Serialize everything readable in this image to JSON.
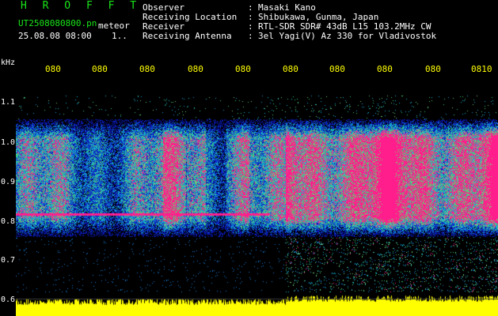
{
  "header": {
    "title": "H R O F F T",
    "filename": "UT2508080800.pn",
    "meteor_label": "meteor",
    "timestamp": "25.08.08 08:00",
    "index": "1..",
    "info": [
      {
        "label": "Observer",
        "value": "Masaki Kano"
      },
      {
        "label": "Receiving Location",
        "value": "Shibukawa, Gunma, Japan"
      },
      {
        "label": "Receiver",
        "value": "RTL-SDR SDR# 43dB L15 103.2MHz CW"
      },
      {
        "label": "Receiving Antenna",
        "value": "3el Yagi(V) Az 330 for Vladivostok"
      }
    ]
  },
  "chart_data": {
    "type": "heatmap",
    "ylabel": "kHz",
    "y_ticks": [
      "1.1",
      "1.0",
      "0.9",
      "0.8",
      "0.7",
      "0.6"
    ],
    "x_ticks": [
      "080",
      "080",
      "080",
      "080",
      "080",
      "080",
      "080",
      "080",
      "080",
      "0810"
    ],
    "ylim": [
      0.6,
      1.1
    ],
    "grid": false,
    "colors": {
      "background": "#000000",
      "low": "#0a1a8c",
      "mid": "#19d2d2",
      "high": "#ff1e8c",
      "power_trace": "#ffff00"
    }
  }
}
